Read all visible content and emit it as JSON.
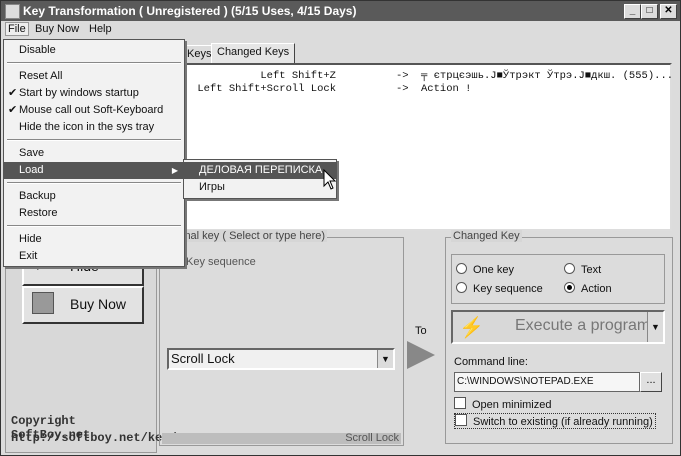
{
  "window": {
    "title": "Key Transformation ( Unregistered ) (5/15 Uses, 4/15 Days)"
  },
  "titlebar_buttons": {
    "minimize": "_",
    "maximize": "□",
    "close": "✕"
  },
  "menubar": {
    "file": "File",
    "buy_now": "Buy Now",
    "help": "Help"
  },
  "file_menu": {
    "disable": "Disable",
    "reset_all": "Reset All",
    "start_with_windows": "Start by windows startup",
    "mouse_call_out": "Mouse call out Soft-Keyboard",
    "hide_icon": "Hide the icon in the sys tray",
    "save": "Save",
    "load": "Load",
    "backup": "Backup",
    "restore": "Restore",
    "hide": "Hide",
    "exit": "Exit",
    "checked_start_with_windows": true,
    "checked_mouse_call_out": true
  },
  "load_submenu": {
    "item1": "ДЕЛОВАЯ ПЕРЕПИСКА",
    "item2": "Игры"
  },
  "tabs": {
    "keys_fragment": "Keys",
    "changed_keys": "Changed Keys"
  },
  "changed_keys_list": [
    {
      "key": "Left Shift+Z",
      "arrow": "->",
      "value": "╤ єтрцєэшь.Ј■Ўтрэкт Ўтрэ.Ј■дкш. (555)..."
    },
    {
      "key": "Left Shift+Scroll Lock",
      "arrow": "->",
      "value": "Action !"
    }
  ],
  "left_panel": {
    "hide_button": "Hide",
    "buy_now_button": "Buy Now",
    "copyright": "Copyright  SoftBoy.net",
    "url": "http://softboy.net/key/"
  },
  "original_key": {
    "group_title": "inal key ( Select or type here)",
    "key_sequence_label": "Key sequence",
    "selected_key": "Scroll Lock",
    "status": "Scroll Lock"
  },
  "to_label": "To",
  "changed_key": {
    "group_title": "Changed Key",
    "one_key": "One key",
    "text": "Text",
    "key_sequence": "Key sequence",
    "action": "Action",
    "selected": "Action",
    "action_value": "Execute a program",
    "command_line_label": "Command line:",
    "command_line_value": "C:\\WINDOWS\\NOTEPAD.EXE",
    "browse_button": "...",
    "open_minimized": "Open minimized",
    "switch_to_existing": "Switch to existing (if already running)"
  }
}
